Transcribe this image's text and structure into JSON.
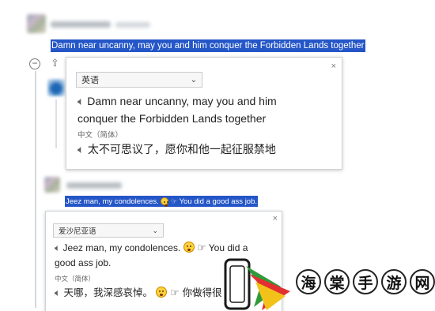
{
  "comment1": {
    "username": "",
    "time": "",
    "text": "Damn near uncanny, may you and him conquer the Forbidden Lands together"
  },
  "controls": {
    "collapse": "−",
    "upvote": "⇧"
  },
  "popup1": {
    "language": "英语",
    "source_text_line1": "Damn near uncanny, may you and him",
    "source_text_line2": "conquer the Forbidden Lands together",
    "target_label": "中文（简体）",
    "target_text": "太不可思议了，愿你和他一起征服禁地",
    "close": "×"
  },
  "comment2": {
    "username": "",
    "text_part1": "Jeez man, my condolences.",
    "text_part2": "You did a good ass job."
  },
  "popup2": {
    "language": "爱沙尼亚语",
    "source_text_line1": "Jeez man, my condolences.",
    "source_text_line1_tail": "You did a",
    "source_text_line2": "good ass job.",
    "target_label": "中文（简体）",
    "target_text_part1": "天哪，我深感哀悼。",
    "target_text_part2": "你做得很",
    "close": "×"
  },
  "watermark": {
    "chars": [
      "海",
      "棠",
      "手",
      "游",
      "网"
    ]
  },
  "icons": {
    "speaker": "speaker-icon",
    "chevron": "chevron-down-icon",
    "close": "close-icon",
    "face": "face-emoji-icon",
    "hand": "pointing-hand-emoji-icon"
  }
}
